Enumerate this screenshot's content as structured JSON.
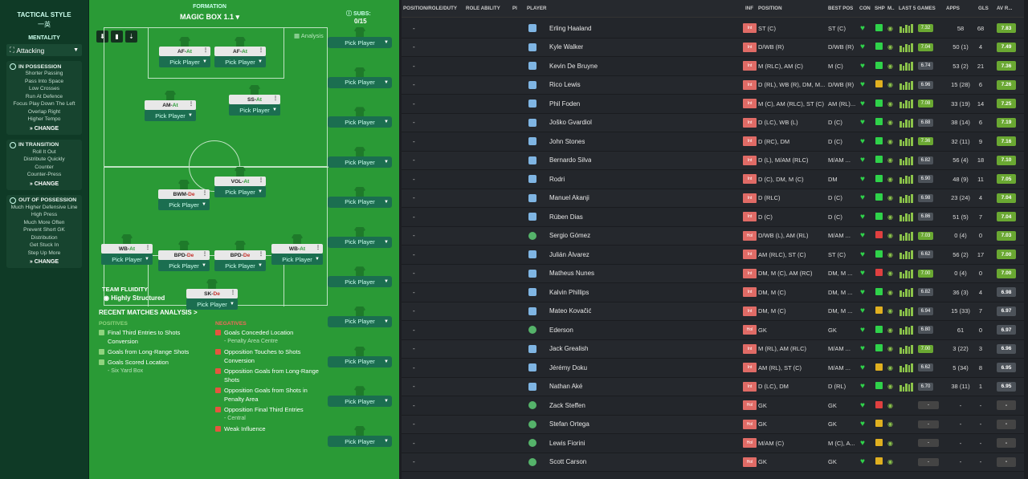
{
  "tactics": {
    "title": "TACTICAL STYLE",
    "style": "一英",
    "mentality_label": "MENTALITY",
    "mentality": "Attacking",
    "in_possession": {
      "title": "IN POSSESSION",
      "items": [
        "Shorter Passing",
        "Pass Into Space",
        "Low Crosses",
        "Run At Defence",
        "Focus Play Down The Left",
        "Overlap Right",
        "Higher Tempo"
      ]
    },
    "in_transition": {
      "title": "IN TRANSITION",
      "items": [
        "Roll It Out",
        "Distribute Quickly",
        "Counter",
        "Counter-Press"
      ]
    },
    "out_of_possession": {
      "title": "OUT OF POSSESSION",
      "items": [
        "Much Higher Defensive Line",
        "High Press",
        "Much More Often",
        "Prevent Short GK",
        "Distribution",
        "Get Stuck In",
        "Step Up More"
      ]
    },
    "change_label": "CHANGE"
  },
  "formation": {
    "label": "FORMATION",
    "name": "MAGIC BOX 1.1",
    "subs_label": "SUBS:",
    "subs_count": "0/15",
    "analysis": "Analysis",
    "pick_player": "Pick Player",
    "fluidity_label": "TEAM FLUIDITY",
    "fluidity": "Highly Structured",
    "slots": [
      {
        "role": "AF",
        "duty": "At"
      },
      {
        "role": "AF",
        "duty": "At"
      },
      {
        "role": "AM",
        "duty": "At"
      },
      {
        "role": "SS",
        "duty": "At"
      },
      {
        "role": "VOL",
        "duty": "At"
      },
      {
        "role": "BWM",
        "duty": "De"
      },
      {
        "role": "WB",
        "duty": "At"
      },
      {
        "role": "BPD",
        "duty": "De"
      },
      {
        "role": "BPD",
        "duty": "De"
      },
      {
        "role": "WB",
        "duty": "At"
      },
      {
        "role": "SK",
        "duty": "De"
      }
    ]
  },
  "analysis": {
    "title": "RECENT MATCHES ANALYSIS >",
    "positives_label": "POSITIVES",
    "negatives_label": "NEGATIVES",
    "positives": [
      {
        "t": "Final Third Entries to Shots Conversion",
        "s": ""
      },
      {
        "t": "Goals from Long-Range Shots",
        "s": ""
      },
      {
        "t": "Goals Scored Location",
        "s": "- Six Yard Box"
      }
    ],
    "negatives": [
      {
        "t": "Goals Conceded Location",
        "s": "- Penalty Area Centre"
      },
      {
        "t": "Opposition Touches to Shots Conversion",
        "s": ""
      },
      {
        "t": "Opposition Goals from Long-Range Shots",
        "s": ""
      },
      {
        "t": "Opposition Goals from Shots in Penalty Area",
        "s": ""
      },
      {
        "t": "Opposition Final Third Entries",
        "s": "- Central"
      },
      {
        "t": "Weak Influence",
        "s": ""
      }
    ]
  },
  "table": {
    "headers": [
      "POSITION/ROLE/DUTY",
      "ROLE ABILITY",
      "PI",
      "PLAYER",
      "INF",
      "POSITION",
      "BEST POS",
      "CON",
      "SHP",
      "M..",
      "LAST 5 GAMES",
      "APPS",
      "GLS",
      "AV R..."
    ],
    "rows": [
      {
        "name": "Erling Haaland",
        "inf": "Int",
        "pos": "ST (C)",
        "best": "ST (C)",
        "last": "7.32",
        "apps": "58",
        "gls": "68",
        "av": "7.83"
      },
      {
        "name": "Kyle Walker",
        "inf": "Int",
        "pos": "D/WB (R)",
        "best": "D/WB (R)",
        "last": "7.04",
        "apps": "50 (1)",
        "gls": "4",
        "av": "7.49"
      },
      {
        "name": "Kevin De Bruyne",
        "inf": "Int",
        "pos": "M (RLC), AM (C)",
        "best": "M (C)",
        "last": "6.74",
        "apps": "53 (2)",
        "gls": "21",
        "av": "7.36"
      },
      {
        "name": "Rico Lewis",
        "inf": "Int",
        "pos": "D (RL), WB (R), DM, M...",
        "best": "D/WB (R)",
        "last": "6.96",
        "apps": "15 (28)",
        "gls": "6",
        "av": "7.26"
      },
      {
        "name": "Phil Foden",
        "inf": "Int",
        "pos": "M (C), AM (RLC), ST (C)",
        "best": "AM (RL)...",
        "last": "7.08",
        "apps": "33 (19)",
        "gls": "14",
        "av": "7.25"
      },
      {
        "name": "Joško Gvardiol",
        "inf": "Int",
        "pos": "D (LC), WB (L)",
        "best": "D (C)",
        "last": "6.88",
        "apps": "38 (14)",
        "gls": "6",
        "av": "7.19"
      },
      {
        "name": "John Stones",
        "inf": "Int",
        "pos": "D (RC), DM",
        "best": "D (C)",
        "last": "7.36",
        "apps": "32 (11)",
        "gls": "9",
        "av": "7.16"
      },
      {
        "name": "Bernardo Silva",
        "inf": "Int",
        "pos": "D (L), M/AM (RLC)",
        "best": "M/AM ...",
        "last": "6.82",
        "apps": "56 (4)",
        "gls": "18",
        "av": "7.10"
      },
      {
        "name": "Rodri",
        "inf": "Int",
        "pos": "D (C), DM, M (C)",
        "best": "DM",
        "last": "6.90",
        "apps": "48 (9)",
        "gls": "11",
        "av": "7.05"
      },
      {
        "name": "Manuel Akanji",
        "inf": "Int",
        "pos": "D (RLC)",
        "best": "D (C)",
        "last": "6.98",
        "apps": "23 (24)",
        "gls": "4",
        "av": "7.04"
      },
      {
        "name": "Rúben Dias",
        "inf": "Int",
        "pos": "D (C)",
        "best": "D (C)",
        "last": "6.86",
        "apps": "51 (5)",
        "gls": "7",
        "av": "7.04"
      },
      {
        "name": "Sergio Gómez",
        "inf": "Hol",
        "pos": "D/WB (L), AM (RL)",
        "best": "M/AM ...",
        "last": "7.03",
        "apps": "0 (4)",
        "gls": "0",
        "av": "7.03"
      },
      {
        "name": "Julián Álvarez",
        "inf": "Int",
        "pos": "AM (RLC), ST (C)",
        "best": "ST (C)",
        "last": "6.62",
        "apps": "56 (2)",
        "gls": "17",
        "av": "7.00"
      },
      {
        "name": "Matheus Nunes",
        "inf": "Int",
        "pos": "DM, M (C), AM (RC)",
        "best": "DM, M ...",
        "last": "7.00",
        "apps": "0 (4)",
        "gls": "0",
        "av": "7.00"
      },
      {
        "name": "Kalvin Phillips",
        "inf": "Int",
        "pos": "DM, M (C)",
        "best": "DM, M ...",
        "last": "6.82",
        "apps": "36 (3)",
        "gls": "4",
        "av": "6.98"
      },
      {
        "name": "Mateo Kovačić",
        "inf": "Int",
        "pos": "DM, M (C)",
        "best": "DM, M ...",
        "last": "6.94",
        "apps": "15 (33)",
        "gls": "7",
        "av": "6.97"
      },
      {
        "name": "Ederson",
        "inf": "Hol",
        "pos": "GK",
        "best": "GK",
        "last": "6.80",
        "apps": "61",
        "gls": "0",
        "av": "6.97"
      },
      {
        "name": "Jack Grealish",
        "inf": "Int",
        "pos": "M (RL), AM (RLC)",
        "best": "M/AM ...",
        "last": "7.00",
        "apps": "3 (22)",
        "gls": "3",
        "av": "6.96"
      },
      {
        "name": "Jérémy Doku",
        "inf": "Int",
        "pos": "AM (RL), ST (C)",
        "best": "M/AM ...",
        "last": "6.62",
        "apps": "5 (34)",
        "gls": "8",
        "av": "6.95"
      },
      {
        "name": "Nathan Aké",
        "inf": "Int",
        "pos": "D (LC), DM",
        "best": "D (RL)",
        "last": "6.70",
        "apps": "38 (11)",
        "gls": "1",
        "av": "6.95"
      },
      {
        "name": "Zack Steffen",
        "inf": "Hol",
        "pos": "GK",
        "best": "GK",
        "last": "-",
        "apps": "-",
        "gls": "-",
        "av": "-"
      },
      {
        "name": "Stefan Ortega",
        "inf": "Hol",
        "pos": "GK",
        "best": "GK",
        "last": "-",
        "apps": "-",
        "gls": "-",
        "av": "-"
      },
      {
        "name": "Lewis Fiorini",
        "inf": "Hol",
        "pos": "M/AM (C)",
        "best": "M (C), A...",
        "last": "-",
        "apps": "-",
        "gls": "-",
        "av": "-"
      },
      {
        "name": "Scott Carson",
        "inf": "Hol",
        "pos": "GK",
        "best": "GK",
        "last": "-",
        "apps": "-",
        "gls": "-",
        "av": "-"
      }
    ]
  },
  "colors": {
    "pitch": "#2a9a36",
    "accent": "#8bc34a"
  }
}
